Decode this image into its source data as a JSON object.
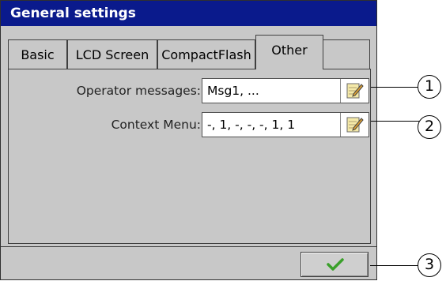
{
  "window": {
    "title": "General settings"
  },
  "tabs": [
    {
      "label": "Basic"
    },
    {
      "label": "LCD Screen"
    },
    {
      "label": "CompactFlash"
    },
    {
      "label": "Other",
      "active": true
    }
  ],
  "fields": {
    "operator_messages": {
      "label": "Operator messages:",
      "value": "Msg1, ..."
    },
    "context_menu": {
      "label": "Context Menu:",
      "value": "-, 1, -, -, -, 1, 1"
    }
  },
  "footer": {
    "ok_icon": "checkmark-icon"
  },
  "callouts": [
    "1",
    "2",
    "3"
  ],
  "colors": {
    "titlebar": "#0a1a8c",
    "panel": "#c8c8c8",
    "ok_check": "#3aa02a"
  }
}
